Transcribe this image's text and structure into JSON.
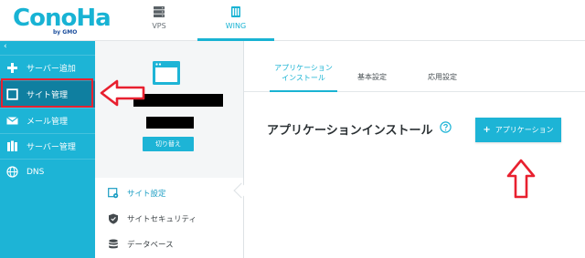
{
  "header": {
    "logo": {
      "word": "ConoHa",
      "sub": "by GMO"
    },
    "tabs": [
      {
        "label": "VPS",
        "icon": "server-icon",
        "active": false
      },
      {
        "label": "WING",
        "icon": "wing-server-icon",
        "active": true
      }
    ]
  },
  "sidebar": {
    "collapse_glyph": "‹",
    "items": [
      {
        "label": "サーバー追加",
        "icon": "plus-icon"
      },
      {
        "label": "サイト管理",
        "icon": "window-icon",
        "active": true
      },
      {
        "label": "メール管理",
        "icon": "mail-icon"
      },
      {
        "label": "サーバー管理",
        "icon": "servers-icon"
      },
      {
        "label": "DNS",
        "icon": "globe-icon"
      }
    ]
  },
  "site_panel": {
    "switch_label": "切り替え",
    "menu": [
      {
        "label": "サイト設定",
        "icon": "site-settings-icon",
        "active": true
      },
      {
        "label": "サイトセキュリティ",
        "icon": "shield-icon"
      },
      {
        "label": "データベース",
        "icon": "database-icon"
      }
    ]
  },
  "main": {
    "subtabs": [
      {
        "label_line1": "アプリケーション",
        "label_line2": "インストール",
        "active": true
      },
      {
        "label": "基本設定"
      },
      {
        "label": "応用設定"
      }
    ],
    "page_title": "アプリケーションインストール",
    "add_button": {
      "plus": "+",
      "label": "アプリケーション"
    }
  },
  "colors": {
    "brand": "#1db4d6",
    "active_sidebar": "#0f7fa0",
    "annotation_red": "#e8202f"
  }
}
